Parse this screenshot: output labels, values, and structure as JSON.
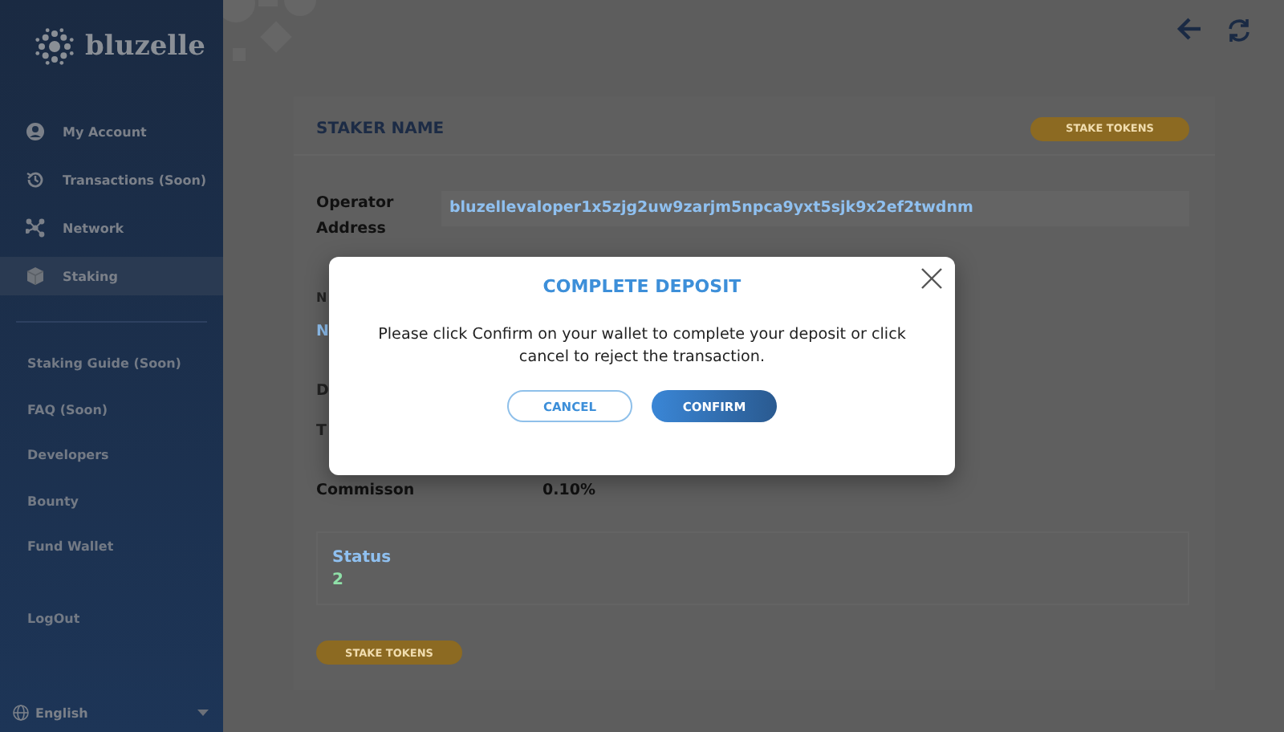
{
  "sidebar": {
    "logo": "bluzelle",
    "nav": [
      {
        "label": "My Account",
        "selected": false
      },
      {
        "label": "Transactions (Soon)",
        "selected": false
      },
      {
        "label": "Network",
        "selected": false
      },
      {
        "label": "Staking",
        "selected": true
      }
    ],
    "links": [
      {
        "label": "Staking Guide (Soon)"
      },
      {
        "label": "FAQ (Soon)"
      },
      {
        "label": "Developers"
      },
      {
        "label": "Bounty"
      },
      {
        "label": "Fund Wallet"
      }
    ],
    "logout": "LogOut",
    "language": "English"
  },
  "card": {
    "title": "STAKER NAME",
    "stake_button": "STAKE TOKENS",
    "operator_label": "Operator Address",
    "operator_address": "bluzellevaloper1x5zjg2uw9zarjm5npca9yxt5sjk9x2ef2twdnm",
    "hidden_rows": [
      {
        "text": "N",
        "kind": "label"
      },
      {
        "text": "N",
        "kind": "link"
      },
      {
        "text": "D",
        "kind": "label"
      },
      {
        "text": "T",
        "kind": "label"
      }
    ],
    "commission_label": "Commisson",
    "commission_value": "0.10%",
    "status_label": "Status",
    "status_value": "2"
  },
  "bottom_button": "STAKE TOKENS",
  "modal": {
    "title": "COMPLETE DEPOSIT",
    "message": "Please click Confirm on your wallet to complete your deposit or click cancel to reject the transaction.",
    "cancel": "CANCEL",
    "confirm": "CONFIRM"
  }
}
